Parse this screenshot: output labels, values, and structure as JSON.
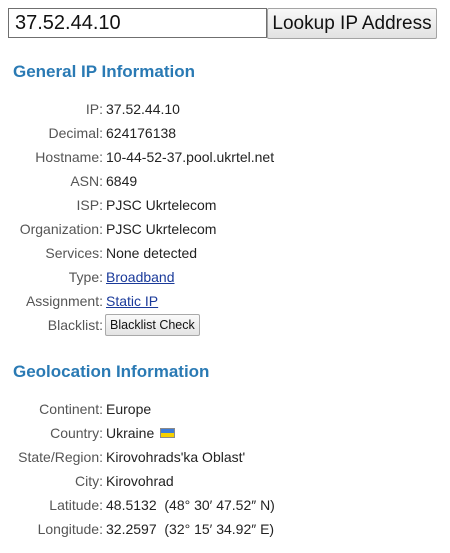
{
  "lookup": {
    "input_value": "37.52.44.10",
    "button_label": "Lookup IP Address"
  },
  "general": {
    "title": "General IP Information",
    "rows": [
      {
        "label": "IP:",
        "value": "37.52.44.10"
      },
      {
        "label": "Decimal:",
        "value": "624176138"
      },
      {
        "label": "Hostname:",
        "value": "10-44-52-37.pool.ukrtel.net"
      },
      {
        "label": "ASN:",
        "value": "6849"
      },
      {
        "label": "ISP:",
        "value": "PJSC Ukrtelecom"
      },
      {
        "label": "Organization:",
        "value": "PJSC Ukrtelecom"
      },
      {
        "label": "Services:",
        "value": "None detected"
      },
      {
        "label": "Type:",
        "value": "Broadband"
      },
      {
        "label": "Assignment:",
        "value": "Static IP"
      },
      {
        "label": "Blacklist:",
        "value": "Blacklist Check"
      }
    ]
  },
  "geo": {
    "title": "Geolocation Information",
    "rows": [
      {
        "label": "Continent:",
        "value": "Europe"
      },
      {
        "label": "Country:",
        "value": "Ukraine"
      },
      {
        "label": "State/Region:",
        "value": "Kirovohrads'ka Oblast'"
      },
      {
        "label": "City:",
        "value": "Kirovohrad"
      },
      {
        "label": "Latitude:",
        "value": "48.5132  (48° 30′ 47.52″ N)"
      },
      {
        "label": "Longitude:",
        "value": "32.2597  (32° 15′ 34.92″ E)"
      }
    ]
  },
  "flag": {
    "icon": "ukraine-flag-icon",
    "top_color": "#3c7cd8",
    "bottom_color": "#f6d100"
  },
  "colors": {
    "heading": "#2a7ab4",
    "link": "#1a3a9a",
    "label": "#555555"
  }
}
